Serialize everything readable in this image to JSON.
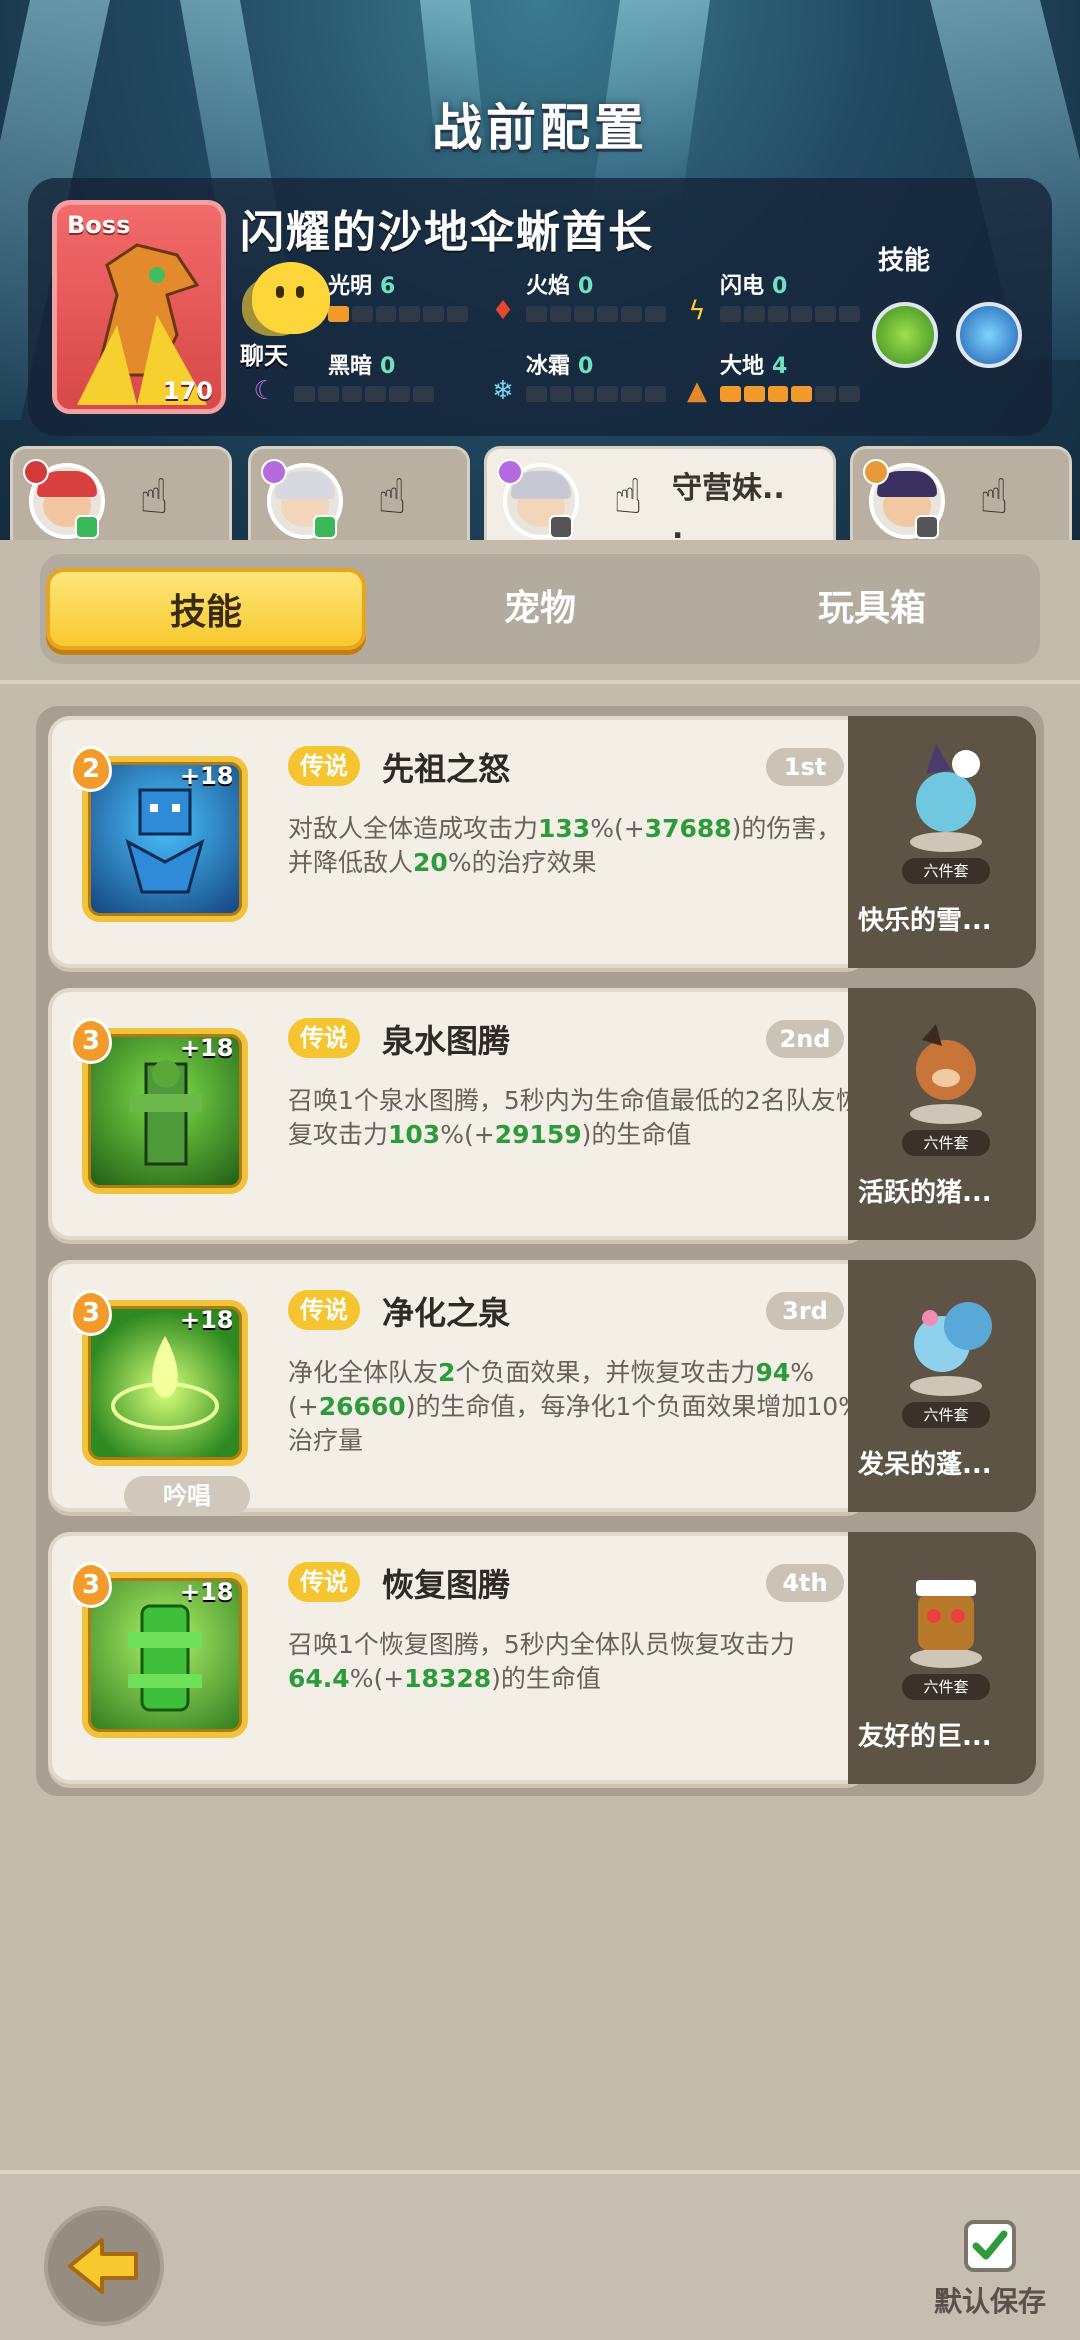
{
  "page": {
    "title": "战前配置"
  },
  "boss": {
    "tag": "Boss",
    "name": "闪耀的沙地伞蜥酋长",
    "level": "170",
    "stats": [
      {
        "name": "光明",
        "value": "6",
        "level": 0,
        "icon": "light-icon"
      },
      {
        "name": "火焰",
        "value": "0",
        "level": 0,
        "icon": "fire-icon"
      },
      {
        "name": "闪电",
        "value": "0",
        "level": 0,
        "icon": "lightning-icon"
      },
      {
        "name": "黑暗",
        "value": "0",
        "level": 0,
        "icon": "dark-moon-icon"
      },
      {
        "name": "冰霜",
        "value": "0",
        "level": 0,
        "icon": "snowflake-icon"
      },
      {
        "name": "大地",
        "value": "4",
        "level": 4,
        "icon": "earth-icon"
      }
    ],
    "skills_label": "技能"
  },
  "chat": {
    "label": "聊天"
  },
  "characters": [
    {
      "name": "",
      "active": false
    },
    {
      "name": "",
      "active": false
    },
    {
      "name": "守营妹..",
      "extra": ".",
      "active": true
    },
    {
      "name": "",
      "active": false
    }
  ],
  "tabs": [
    {
      "label": "技能",
      "active": true
    },
    {
      "label": "宠物",
      "active": false
    },
    {
      "label": "玩具箱",
      "active": false
    }
  ],
  "skills": [
    {
      "level": "2",
      "plus": "+18",
      "rarity": "传说",
      "title": "先祖之怒",
      "rank": "1st",
      "desc_parts": [
        "对敌人全体造成攻击力",
        "133",
        "%(+",
        "37688",
        ")的伤害，并降低敌人",
        "20",
        "%的治疗效果"
      ],
      "chant": "",
      "pet": {
        "set": "六件套",
        "name": "快乐的雪..."
      }
    },
    {
      "level": "3",
      "plus": "+18",
      "rarity": "传说",
      "title": "泉水图腾",
      "rank": "2nd",
      "desc_parts": [
        "召唤1个泉水图腾，5秒内为生命值最低的2名队友恢复攻击力",
        "103",
        "%(+",
        "29159",
        ")的生命值"
      ],
      "chant": "",
      "pet": {
        "set": "六件套",
        "name": "活跃的猪..."
      }
    },
    {
      "level": "3",
      "plus": "+18",
      "rarity": "传说",
      "title": "净化之泉",
      "rank": "3rd",
      "desc_parts": [
        "净化全体队友",
        "2",
        "个负面效果，并恢复攻击力",
        "94",
        "%(+",
        "26660",
        ")的生命值，每净化1个负面效果增加10%治疗量"
      ],
      "chant": "吟唱",
      "pet": {
        "set": "六件套",
        "name": "发呆的蓬..."
      }
    },
    {
      "level": "3",
      "plus": "+18",
      "rarity": "传说",
      "title": "恢复图腾",
      "rank": "4th",
      "desc_parts": [
        "召唤1个恢复图腾，5秒内全体队员恢复攻击力",
        "64.4",
        "%(+",
        "18328",
        ")的生命值"
      ],
      "chant": "",
      "pet": {
        "set": "六件套",
        "name": "友好的巨..."
      }
    }
  ],
  "footer": {
    "save_label": "默认保存"
  },
  "colors": {
    "accent_yellow": "#f7c92e",
    "rarity_gold": "#f4c531",
    "value_green": "#2c9b3a",
    "level_orange": "#f29a2a"
  }
}
